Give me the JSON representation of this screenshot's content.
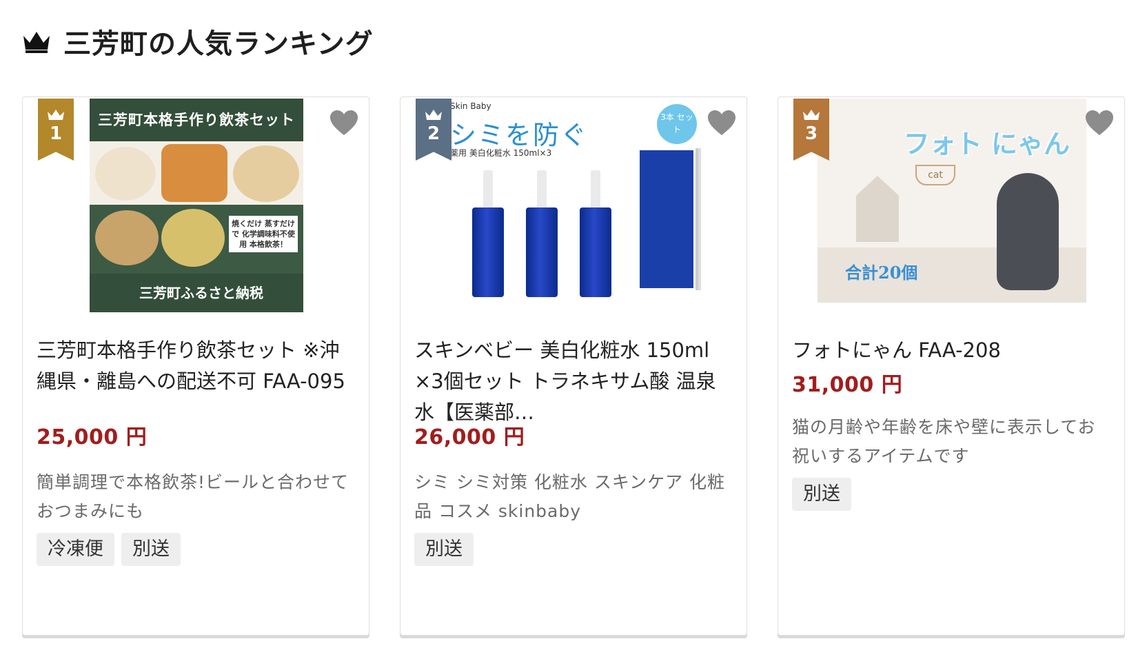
{
  "section": {
    "title": "三芳町の人気ランキング"
  },
  "colors": {
    "price": "#a11d1d",
    "rank1": "#b3882a",
    "rank2": "#5b6f85",
    "rank3": "#b5773a",
    "heart": "#8c8c8c"
  },
  "cards": [
    {
      "rank": "1",
      "title": "三芳町本格手作り飲茶セット ※沖縄県・離島への配送不可 FAA-095",
      "price": "25,000 円",
      "description": "簡単調理で本格飲茶!ビールと合わせておつまみにも",
      "tags": [
        "冷凍便",
        "別送"
      ],
      "image": {
        "top_text": "三芳町本格手作り飲茶セット",
        "note": "焼くだけ 蒸すだけで 化学調味料不使用 本格飲茶！",
        "bottom_text": "三芳町ふるさと納税"
      }
    },
    {
      "rank": "2",
      "title": "スキンベビー 美白化粧水 150ml ×3個セット トラネキサム酸 温泉水【医薬部…",
      "price": "26,000 円",
      "description": "シミ シミ対策 化粧水 スキンケア 化粧品 コスメ skinbaby",
      "tags": [
        "別送"
      ],
      "image": {
        "brand": "Skin Baby",
        "headline": "シミを防ぐ",
        "sub": "薬用 美白化粧水 150ml×3",
        "badge": "3本 セット"
      }
    },
    {
      "rank": "3",
      "title": "フォトにゃん FAA-208",
      "price": "31,000 円",
      "description": "猫の月齢や年齢を床や壁に表示してお祝いするアイテムです",
      "tags": [
        "別送"
      ],
      "image": {
        "label": "cat",
        "headline": "フォト にゃん",
        "count": "合計20個"
      }
    }
  ]
}
